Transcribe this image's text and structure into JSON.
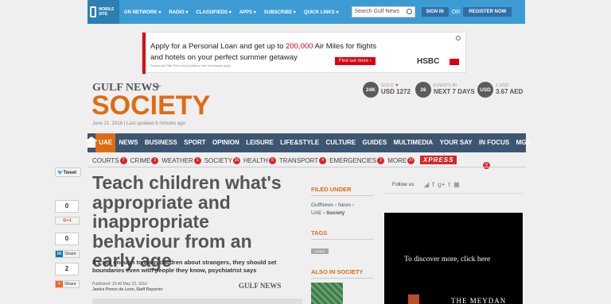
{
  "topbar": {
    "mobile_label": "MOBILE SITE",
    "nav": [
      "GN NETWORK",
      "RADIO",
      "CLASSIFIEDS",
      "APPS",
      "SUBSCRIBE",
      "QUICK LINKS"
    ],
    "search_placeholder": "Search Gulf News",
    "signin": "SIGN IN",
    "or": "OR",
    "register": "REGISTER NOW"
  },
  "ad": {
    "line1_a": "Apply for a Personal Loan and get up to ",
    "line1_b": "200,000",
    "line1_c": " Air Miles for flights",
    "line2": "and hotels on your perfect summer getaway",
    "fine": "Product and Offer Terms and Conditions, fees and charges apply.",
    "cta": "Find out more ›",
    "brand": "HSBC"
  },
  "masthead": {
    "brand": "GULF NEWS",
    "section": "SOCIETY",
    "dateline": "June 21, 2016 | Last updated 6 minutes ago"
  },
  "widgets": {
    "gold": {
      "circle": "24K",
      "label": "GOLD",
      "value": "USD 1272"
    },
    "events": {
      "circle": "26",
      "label": "EVENTS IN",
      "value": "NEXT 7 DAYS"
    },
    "fx": {
      "circle": "USD",
      "label": "1 USD",
      "value": "3.67 AED"
    }
  },
  "nav": [
    "UAE",
    "NEWS",
    "BUSINESS",
    "SPORT",
    "OPINION",
    "LEISURE",
    "LIFE&STYLE",
    "CULTURE",
    "GUIDES",
    "MULTIMEDIA",
    "YOUR SAY",
    "IN FOCUS",
    "MGN"
  ],
  "subnav": [
    {
      "label": "COURTS",
      "count": "7"
    },
    {
      "label": "CRIME",
      "count": "2"
    },
    {
      "label": "WEATHER",
      "count": "1"
    },
    {
      "label": "SOCIETY",
      "count": "16"
    },
    {
      "label": "HEALTH",
      "count": "5"
    },
    {
      "label": "TRANSPORT",
      "count": "4"
    },
    {
      "label": "EMERGENCIES",
      "count": "2"
    },
    {
      "label": "MORE",
      "count": "27"
    }
  ],
  "xpress": {
    "label": "XPRESS",
    "count": "9"
  },
  "share": {
    "tweet": "Tweet",
    "gplus_count": "0",
    "gplus_label": "G+1",
    "linkedin_count": "0",
    "linkedin_label": "Share",
    "share_count": "2",
    "share_label": "Share"
  },
  "article": {
    "headline": "Teach children what's appropriate and inappropriate behaviour from an early age",
    "standfirst": "It's not enough to warn children about strangers, they should set boundaries even with people they know, psychiatrist says",
    "published": "Published: 15:40 May 23, 2016",
    "author": "Janice Ponce de Leon, Staff Reporter",
    "source_logo": "GULF NEWS"
  },
  "sidebar": {
    "filed_under": "FILED UNDER",
    "breadcrumb_1": "GulfNews › News ›",
    "breadcrumb_2_a": "UAE › ",
    "breadcrumb_2_b": "Society",
    "tags": "TAGS",
    "tag_1": "DUBAI",
    "also_in": "ALSO IN SOCIETY"
  },
  "right": {
    "follow": "Follow us",
    "ad_text": "To discover more, click here",
    "ad_brand": "THE MEYDAN"
  }
}
